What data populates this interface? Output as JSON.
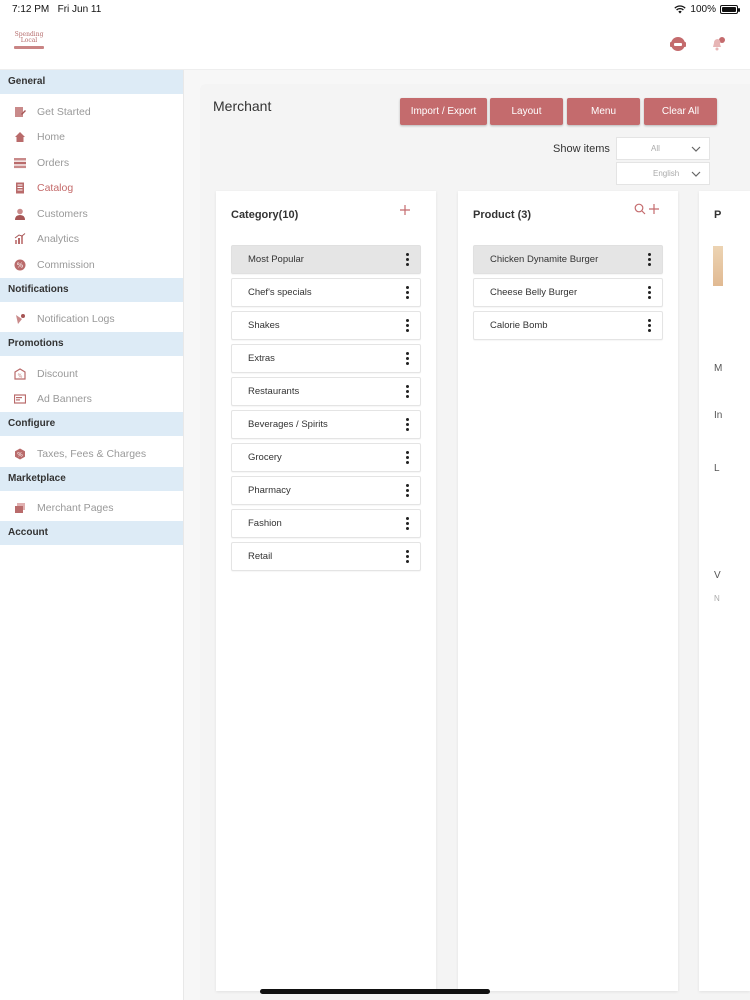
{
  "status": {
    "time": "7:12 PM",
    "date": "Fri Jun 11",
    "battery": "100%"
  },
  "logo": {
    "text_top": "Spending",
    "text_bottom": "Local"
  },
  "sidebar": {
    "sections": [
      {
        "title": "General",
        "items": [
          {
            "label": "Get Started",
            "icon": "get-started-icon"
          },
          {
            "label": "Home",
            "icon": "home-icon"
          },
          {
            "label": "Orders",
            "icon": "orders-icon"
          },
          {
            "label": "Catalog",
            "icon": "catalog-icon",
            "active": true
          },
          {
            "label": "Customers",
            "icon": "customers-icon"
          },
          {
            "label": "Analytics",
            "icon": "analytics-icon"
          },
          {
            "label": "Commission",
            "icon": "commission-icon"
          }
        ]
      },
      {
        "title": "Notifications",
        "items": [
          {
            "label": "Notification Logs",
            "icon": "notification-logs-icon"
          }
        ]
      },
      {
        "title": "Promotions",
        "items": [
          {
            "label": "Discount",
            "icon": "discount-icon"
          },
          {
            "label": "Ad Banners",
            "icon": "ad-banners-icon"
          }
        ]
      },
      {
        "title": "Configure",
        "items": [
          {
            "label": "Taxes, Fees & Charges",
            "icon": "taxes-icon"
          }
        ]
      },
      {
        "title": "Marketplace",
        "items": [
          {
            "label": "Merchant Pages",
            "icon": "merchant-pages-icon"
          }
        ]
      },
      {
        "title": "Account",
        "items": []
      }
    ]
  },
  "main": {
    "title": "Merchant",
    "buttons": {
      "import_export": "Import / Export",
      "layout": "Layout",
      "menu": "Menu",
      "clear_all": "Clear All"
    },
    "show_items_label": "Show items",
    "show_items_value": "All",
    "language_value": "English",
    "category": {
      "title": "Category(10)",
      "items": [
        "Most Popular",
        "Chef's specials",
        "Shakes",
        "Extras",
        "Restaurants",
        "Beverages / Spirits",
        "Grocery",
        "Pharmacy",
        "Fashion",
        "Retail"
      ],
      "selected": 0
    },
    "product": {
      "title": "Product (3)",
      "items": [
        "Chicken Dynamite Burger",
        "Cheese Belly Burger",
        "Calorie Bomb"
      ],
      "selected": 0
    },
    "third_panel_fragments": {
      "title": "P",
      "l1": "M",
      "l2": "In",
      "l3": "L",
      "l4": "V",
      "l5": "N"
    }
  },
  "colors": {
    "accent": "#c46b6d",
    "section_bg": "#ddebf6"
  }
}
